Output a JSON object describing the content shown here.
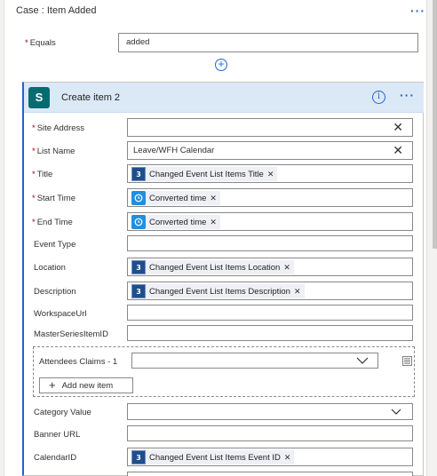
{
  "case": {
    "title": "Case : Item Added",
    "menu_icon": "more-dots-icon"
  },
  "condition": {
    "equals_label": "Equals",
    "equals_value": "added"
  },
  "action": {
    "title": "Create item 2",
    "icon": "sharepoint-logo",
    "info_icon": "info-icon",
    "menu_icon": "more-dots-icon",
    "fields": {
      "site_address": {
        "label": "Site Address",
        "value": ""
      },
      "list_name": {
        "label": "List Name",
        "value": "Leave/WFH Calendar"
      },
      "title": {
        "label": "Title",
        "token": "Changed Event List Items Title"
      },
      "start_time": {
        "label": "Start Time",
        "token": "Converted time"
      },
      "end_time": {
        "label": "End Time",
        "token": "Converted time"
      },
      "event_type": {
        "label": "Event Type",
        "value": ""
      },
      "location": {
        "label": "Location",
        "token": "Changed Event List Items Location"
      },
      "description": {
        "label": "Description",
        "token": "Changed Event List Items Description"
      },
      "workspace_url": {
        "label": "WorkspaceUrl",
        "value": ""
      },
      "master_series_item_id": {
        "label": "MasterSeriesItemID",
        "value": ""
      },
      "attendees": {
        "label": "Attendees Claims - 1",
        "value": "",
        "add_button": "Add new item"
      },
      "category_value": {
        "label": "Category Value",
        "value": ""
      },
      "banner_url": {
        "label": "Banner URL",
        "value": ""
      },
      "calendar_id": {
        "label": "CalendarID",
        "token": "Changed Event List Items Event ID"
      }
    }
  },
  "colors": {
    "accent": "#2266c7",
    "header_bg": "#dbe9f7",
    "required": "#a80000",
    "token_bg": "#eef0f6"
  }
}
